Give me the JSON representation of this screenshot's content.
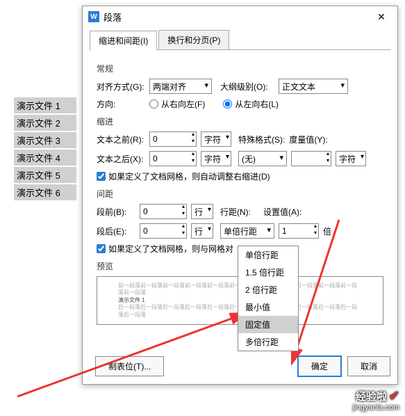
{
  "files": [
    "演示文件 1",
    "演示文件 2",
    "演示文件 3",
    "演示文件 4",
    "演示文件 5",
    "演示文件 6"
  ],
  "dialog": {
    "title": "段落",
    "tabs": {
      "t1": "缩进和间距(I)",
      "t2": "换行和分页(P)"
    },
    "general": {
      "title": "常规",
      "align_label": "对齐方式(G):",
      "align_value": "两端对齐",
      "outline_label": "大纲级别(O):",
      "outline_value": "正文文本",
      "dir_label": "方向:",
      "dir_rtl": "从右向左(F)",
      "dir_ltr": "从左向右(L)"
    },
    "indent": {
      "title": "缩进",
      "before_label": "文本之前(R):",
      "before_value": "0",
      "after_label": "文本之后(X):",
      "after_value": "0",
      "unit": "字符",
      "special_label": "特殊格式(S):",
      "special_value": "(无)",
      "metric_label": "度量值(Y):",
      "metric_value": "",
      "metric_unit": "字符",
      "grid_cb": "如果定义了文档网格，则自动调整右缩进(D)"
    },
    "spacing": {
      "title": "间距",
      "before_label": "段前(B):",
      "before_value": "0",
      "after_label": "段后(E):",
      "after_value": "0",
      "unit": "行",
      "line_label": "行距(N):",
      "line_value": "单倍行距",
      "set_label": "设置值(A):",
      "set_value": "1",
      "set_unit": "倍",
      "grid_cb": "如果定义了文档网格，则与网格对",
      "options": [
        "单倍行距",
        "1.5 倍行距",
        "2 倍行距",
        "最小值",
        "固定值",
        "多倍行距"
      ]
    },
    "preview": {
      "title": "预览",
      "sample": "演示文件 1"
    },
    "buttons": {
      "tabstops": "制表位(T)...",
      "ok": "确定",
      "cancel": "取消"
    }
  },
  "watermark": {
    "brand": "经验啦",
    "url": "jingyanla.com"
  }
}
